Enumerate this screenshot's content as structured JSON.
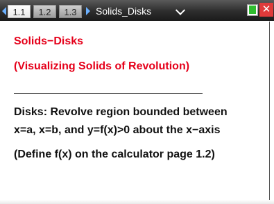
{
  "tabs": [
    {
      "label": "1.1",
      "active": true
    },
    {
      "label": "1.2",
      "active": false
    },
    {
      "label": "1.3",
      "active": false
    }
  ],
  "document_title": "Solids_Disks",
  "content": {
    "title": "Solids−Disks",
    "subtitle": "(Visualizing Solids of Revolution)",
    "paragraph_line1": "Disks:  Revolve region bounded between",
    "paragraph_line2": "x=a, x=b, and y=f(x)>0 about the x−axis",
    "note": "(Define f(x) on the calculator page 1.2)"
  },
  "colors": {
    "accent_red": "#e5001a",
    "tab_arrow": "#6ab0ff",
    "battery": "#2fbd2f",
    "close": "#e03a3a"
  },
  "icons": {
    "prev": "arrow-left-icon",
    "next": "arrow-right-icon",
    "menu": "chevron-down-icon",
    "battery": "battery-icon",
    "close": "close-icon"
  }
}
